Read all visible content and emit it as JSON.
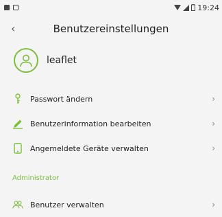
{
  "status_bar": {
    "time": "19:24"
  },
  "header": {
    "back_label": "‹",
    "title": "Benutzereinstellungen"
  },
  "user": {
    "name": "leaflet"
  },
  "menu": [
    {
      "label": "Passwort ändern",
      "icon": "key-icon"
    },
    {
      "label": "Benutzerinformation bearbeiten",
      "icon": "pencil-icon"
    },
    {
      "label": "Angemeldete Geräte verwalten",
      "icon": "phone-icon"
    }
  ],
  "section": {
    "label": "Administrator"
  },
  "admin_menu": [
    {
      "label": "Benutzer verwalten",
      "icon": "users-icon"
    }
  ],
  "colors": {
    "accent": "#7cbf3c",
    "background": "#f4f4f4"
  }
}
